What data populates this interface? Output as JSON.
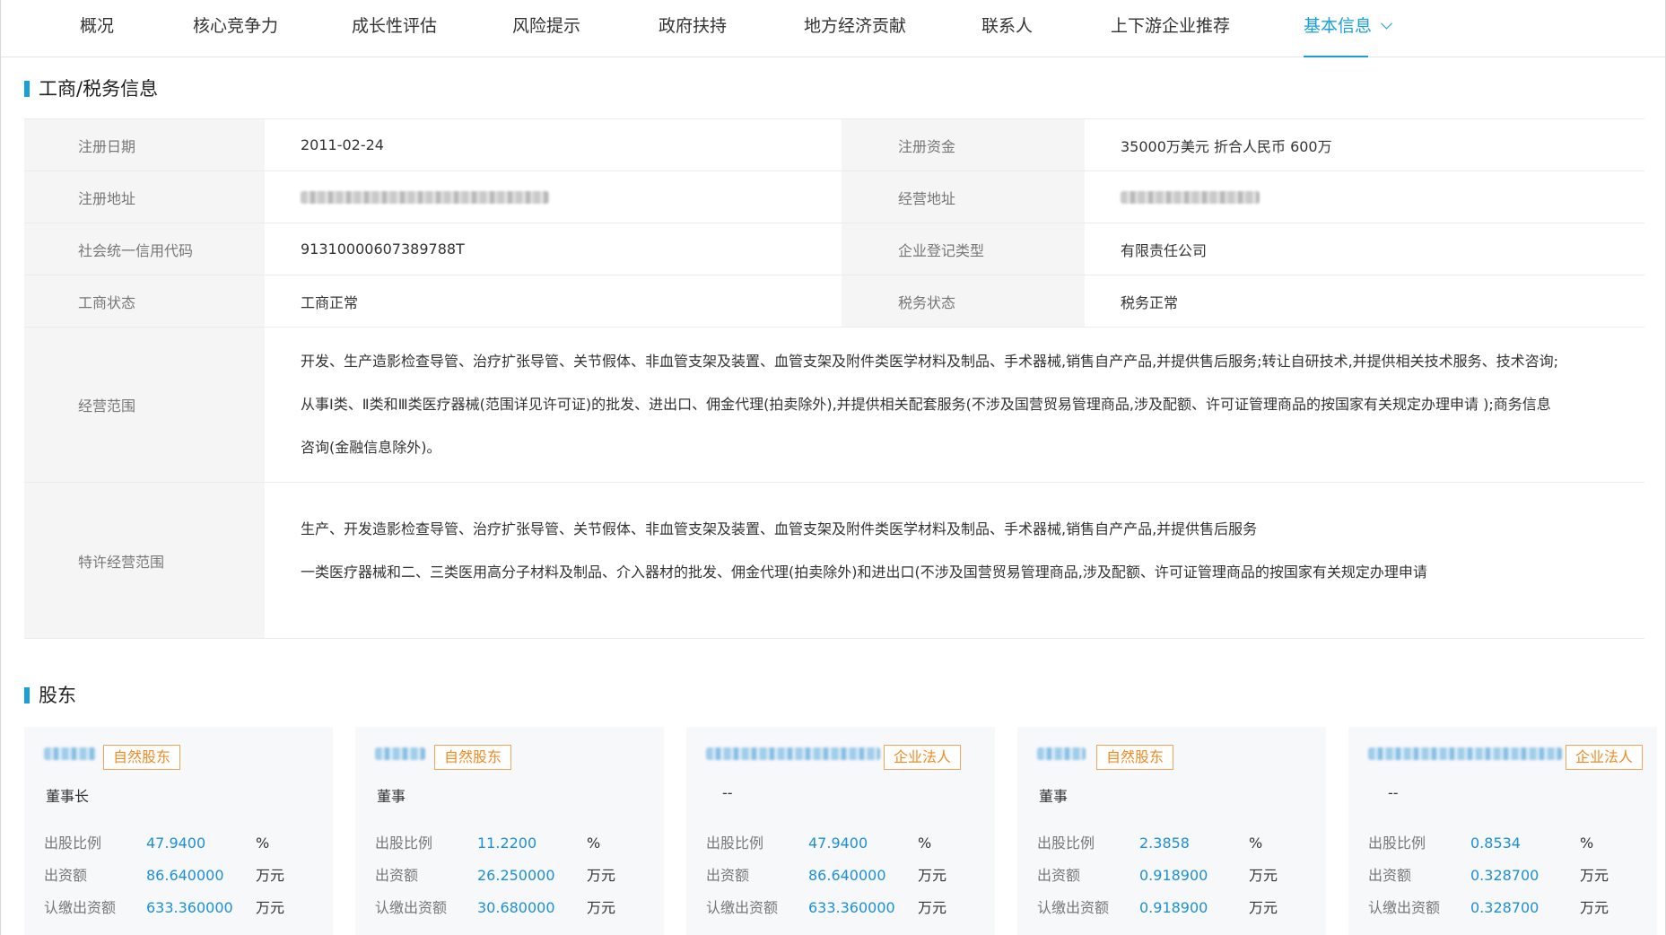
{
  "tabs": [
    {
      "label": "概况"
    },
    {
      "label": "核心竞争力"
    },
    {
      "label": "成长性评估"
    },
    {
      "label": "风险提示"
    },
    {
      "label": "政府扶持"
    },
    {
      "label": "地方经济贡献"
    },
    {
      "label": "联系人"
    },
    {
      "label": "上下游企业推荐"
    },
    {
      "label": "基本信息"
    }
  ],
  "accent_color": "#1aa0d8",
  "business_section": {
    "title": "工商/税务信息",
    "reg_date_label": "注册日期",
    "reg_date": "2011-02-24",
    "reg_capital_label": "注册资金",
    "reg_capital": "35000万美元  折合人民币 600万",
    "reg_address_label": "注册地址",
    "op_address_label": "经营地址",
    "credit_code_label": "社会统一信用代码",
    "credit_code": "91310000607389788T",
    "company_type_label": "企业登记类型",
    "company_type": "有限责任公司",
    "biz_status_label": "工商状态",
    "biz_status": "工商正常",
    "tax_status_label": "税务状态",
    "tax_status": "税务正常",
    "scope_label": "经营范围",
    "scope_lines": [
      "开发、生产造影检查导管、治疗扩张导管、关节假体、非血管支架及装置、血管支架及附件类医学材料及制品、手术器械,销售自产产品,并提供售后服务;转让自研技术,并提供相关技术服务、技术咨询;",
      "从事Ⅰ类、Ⅱ类和Ⅲ类医疗器械(范围详见许可证)的批发、进出口、佣金代理(拍卖除外),并提供相关配套服务(不涉及国营贸易管理商品,涉及配额、许可证管理商品的按国家有关规定办理申请 );商务信息",
      "咨询(金融信息除外)。"
    ],
    "licensed_scope_label": "特许经营范围",
    "licensed_scope_lines": [
      "生产、开发造影检查导管、治疗扩张导管、关节假体、非血管支架及装置、血管支架及附件类医学材料及制品、手术器械,销售自产产品,并提供售后服务",
      "一类医疗器械和二、三类医用高分子材料及制品、介入器材的批发、佣金代理(拍卖除外)和进出口(不涉及国营贸易管理商品,涉及配额、许可证管理商品的按国家有关规定办理申请"
    ]
  },
  "shareholders_section": {
    "title": "股东",
    "ratio_label": "出股比例",
    "amount_label": "出资额",
    "subscribed_label": "认缴出资额",
    "percent_unit": "%",
    "money_unit": "万元",
    "cards": [
      {
        "badge": "自然股东",
        "role": "董事长",
        "ratio": "47.9400",
        "amount": "86.640000",
        "subscribed": "633.360000"
      },
      {
        "badge": "自然股东",
        "role": "董事",
        "ratio": "11.2200",
        "amount": "26.250000",
        "subscribed": "30.680000"
      },
      {
        "badge": "企业法人",
        "role": "--",
        "ratio": "47.9400",
        "amount": "86.640000",
        "subscribed": "633.360000"
      },
      {
        "badge": "自然股东",
        "role": "董事",
        "ratio": "2.3858",
        "amount": "0.918900",
        "subscribed": "0.918900"
      },
      {
        "badge": "企业法人",
        "role": "--",
        "ratio": "0.8534",
        "amount": "0.328700",
        "subscribed": "0.328700"
      }
    ]
  }
}
